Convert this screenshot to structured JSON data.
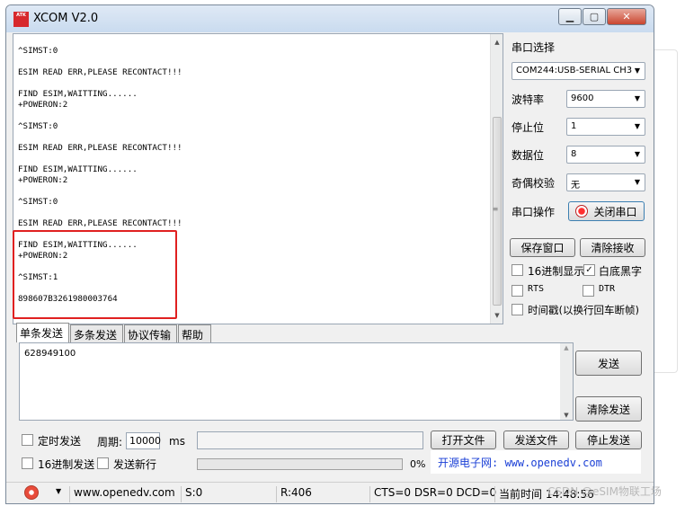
{
  "window": {
    "title": "XCOM V2.0",
    "logo_text": "ATK"
  },
  "output": {
    "lines": "^SIMST:0\n\nESIM READ ERR,PLEASE RECONTACT!!!\n\nFIND ESIM,WAITTING......\n+POWERON:2\n\n^SIMST:0\n\nESIM READ ERR,PLEASE RECONTACT!!!\n\nFIND ESIM,WAITTING......\n+POWERON:2\n\n^SIMST:0\n\nESIM READ ERR,PLEASE RECONTACT!!!\n\nFIND ESIM,WAITTING......\n+POWERON:2\n\n^SIMST:1\n\n898607B3261980003764"
  },
  "settings": {
    "port_label": "串口选择",
    "port_value": "COM244:USB-SERIAL CH3",
    "baud_label": "波特率",
    "baud_value": "9600",
    "stop_label": "停止位",
    "stop_value": "1",
    "data_label": "数据位",
    "data_value": "8",
    "parity_label": "奇偶校验",
    "parity_value": "无",
    "op_label": "串口操作",
    "op_button": "关闭串口",
    "save_button": "保存窗口",
    "clear_recv_button": "清除接收",
    "hex_display_label": "16进制显示",
    "white_bg_label": "白底黑字",
    "rts_label": "RTS",
    "dtr_label": "DTR",
    "timestamp_label": "时间戳(以换行回车断帧)"
  },
  "tabs": [
    "单条发送",
    "多条发送",
    "协议传输",
    "帮助"
  ],
  "send": {
    "text": "628949100",
    "send_button": "发送",
    "clear_send_button": "清除发送",
    "timed_send_label": "定时发送",
    "period_label": "周期:",
    "period_value": "10000",
    "period_unit": "ms",
    "open_file_button": "打开文件",
    "send_file_button": "发送文件",
    "stop_send_button": "停止发送",
    "hex_send_label": "16进制发送",
    "newline_label": "发送新行",
    "progress_percent": "0%",
    "progress_fraction": 0,
    "website_text": "开源电子网: www.openedv.com"
  },
  "status": {
    "url": "www.openedv.com",
    "sent": "S:0",
    "received": "R:406",
    "lines": "CTS=0 DSR=0 DCD=0",
    "time": "当前时间 14:48:56"
  },
  "watermark": "CSDN @eSIM物联工场",
  "colors": {
    "highlight": "#e02020",
    "link": "#1a3fd6",
    "close": "#c9452f"
  }
}
